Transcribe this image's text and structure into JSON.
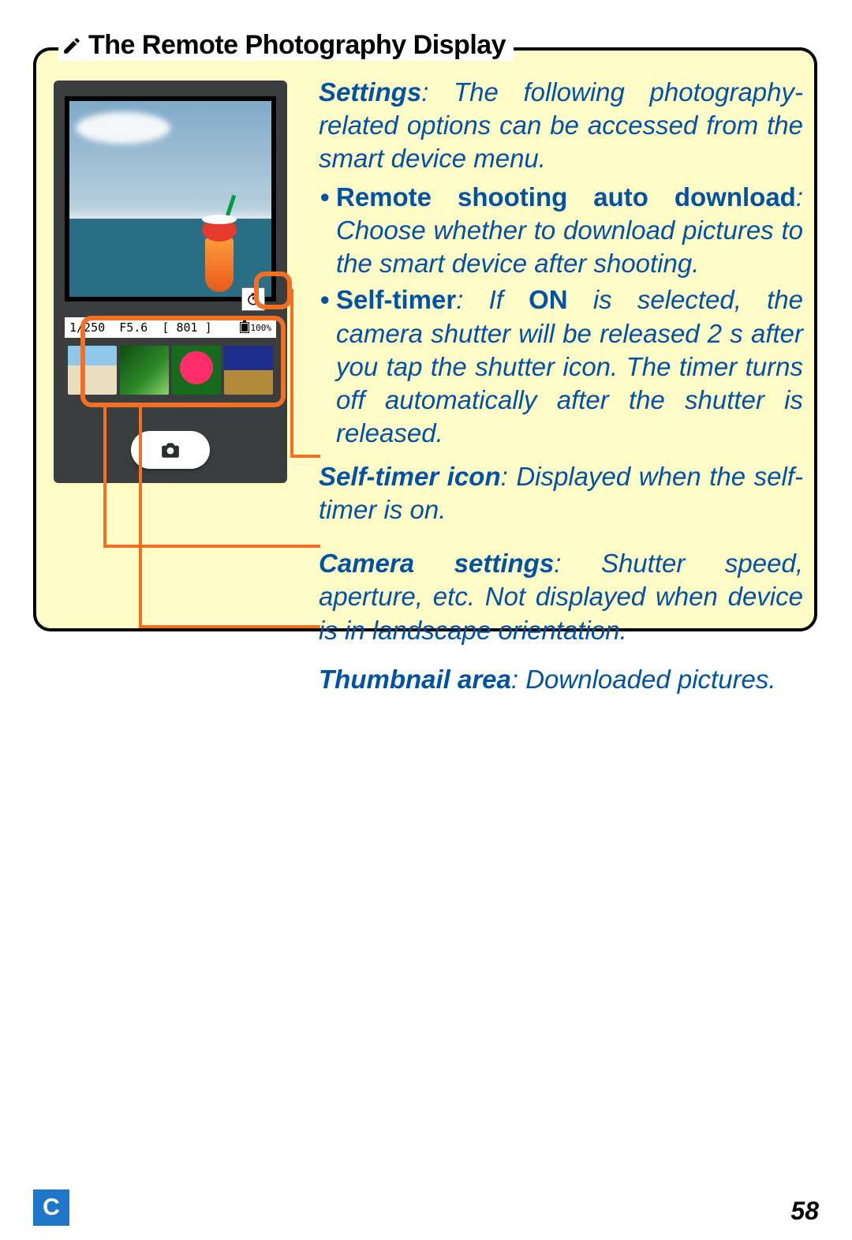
{
  "note": {
    "title": "The Remote Photography Display",
    "settings_lead": "Settings",
    "settings_body": ": The following photography-related options can be accessed from the smart device menu.",
    "bullets": [
      {
        "title": "Remote shooting auto download",
        "body": ": Choose whether to download pictures to the smart device after shooting."
      },
      {
        "title": "Self-timer",
        "body_pre": ": If ",
        "on": "ON",
        "body_post": " is selected, the camera shutter will be released 2 s after you tap the shutter icon. The timer turns off automatically after the shutter is released."
      }
    ],
    "callouts": {
      "self_timer_icon": {
        "title": "Self-timer icon",
        "body": ": Displayed when the self-timer is on."
      },
      "camera_settings": {
        "title": "Camera settings",
        "body": ": Shutter speed, aperture, etc. Not displayed when device is in landscape orientation."
      },
      "thumbnail_area": {
        "title": "Thumbnail area",
        "body": ": Downloaded pictures."
      }
    }
  },
  "phone": {
    "settings_bar": {
      "shutter_speed": "1/250",
      "aperture": "F5.6",
      "remaining": "[ 801 ]",
      "battery": "100%"
    },
    "thumbnails": [
      "beach",
      "jungle-waterfall",
      "pink-flower",
      "night-building"
    ],
    "self_timer_icon": "self-timer"
  },
  "footer": {
    "section_tab": "C",
    "page_number": "58"
  }
}
